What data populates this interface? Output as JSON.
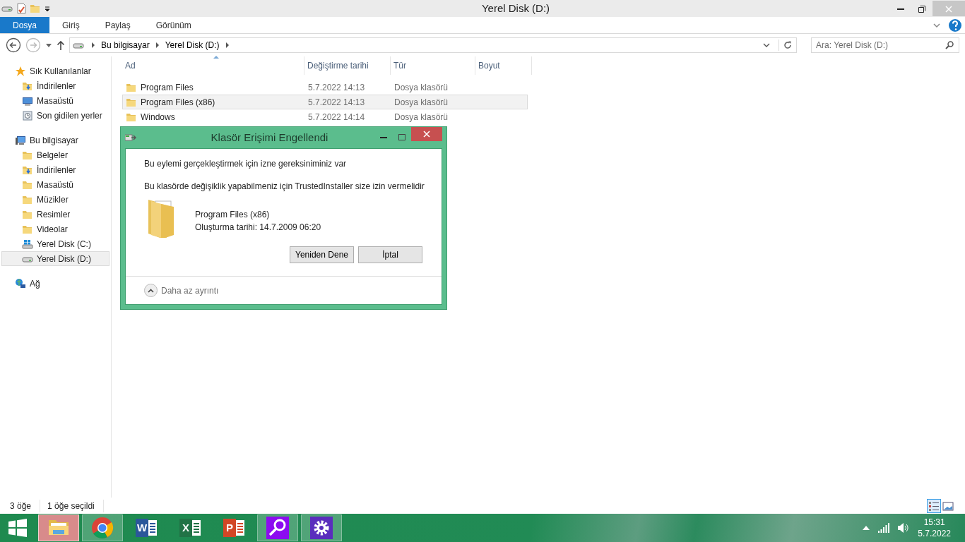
{
  "window": {
    "title": "Yerel Disk (D:)"
  },
  "ribbon_tabs": [
    {
      "label": "Dosya",
      "selected": true
    },
    {
      "label": "Giriş",
      "selected": false
    },
    {
      "label": "Paylaş",
      "selected": false
    },
    {
      "label": "Görünüm",
      "selected": false
    }
  ],
  "address": {
    "crumbs": [
      "Bu bilgisayar",
      "Yerel Disk (D:)"
    ]
  },
  "search": {
    "placeholder": "Ara: Yerel Disk (D:)"
  },
  "sidebar": [
    {
      "label": "Sık Kullanılanlar",
      "kind": "star",
      "selected": false,
      "children": [
        {
          "label": "İndirilenler",
          "kind": "download",
          "selected": false
        },
        {
          "label": "Masaüstü",
          "kind": "desktop",
          "selected": false
        },
        {
          "label": "Son gidilen yerler",
          "kind": "recent",
          "selected": false
        }
      ]
    },
    {
      "label": "Bu bilgisayar",
      "kind": "computer",
      "selected": false,
      "children": [
        {
          "label": "Belgeler",
          "kind": "folder",
          "selected": false
        },
        {
          "label": "İndirilenler",
          "kind": "download",
          "selected": false
        },
        {
          "label": "Masaüstü",
          "kind": "folder",
          "selected": false
        },
        {
          "label": "Müzikler",
          "kind": "folder",
          "selected": false
        },
        {
          "label": "Resimler",
          "kind": "folder",
          "selected": false
        },
        {
          "label": "Videolar",
          "kind": "folder",
          "selected": false
        },
        {
          "label": "Yerel Disk (C:)",
          "kind": "windrive",
          "selected": false
        },
        {
          "label": "Yerel Disk (D:)",
          "kind": "drive",
          "selected": true
        }
      ]
    },
    {
      "label": "Ağ",
      "kind": "network",
      "selected": false
    }
  ],
  "table": {
    "columns": [
      {
        "label": "Ad",
        "sorted": true
      },
      {
        "label": "Değiştirme tarihi",
        "sorted": false
      },
      {
        "label": "Tür",
        "sorted": false
      },
      {
        "label": "Boyut",
        "sorted": false
      }
    ],
    "rows": [
      {
        "name": "Program Files",
        "date": "5.7.2022 14:13",
        "type": "Dosya klasörü",
        "selected": false
      },
      {
        "name": "Program Files (x86)",
        "date": "5.7.2022 14:13",
        "type": "Dosya klasörü",
        "selected": true
      },
      {
        "name": "Windows",
        "date": "5.7.2022 14:14",
        "type": "Dosya klasörü",
        "selected": false
      }
    ]
  },
  "dialog": {
    "title": "Klasör Erişimi Engellendi",
    "message": "Bu eylemi gerçekleştirmek için izne gereksiniminiz var",
    "detail": "Bu klasörde değişiklik yapabilmeniz için TrustedInstaller size izin vermelidir",
    "file_name": "Program Files (x86)",
    "created": "Oluşturma tarihi: 14.7.2009 06:20",
    "buttons": [
      "Yeniden Dene",
      "İptal"
    ],
    "toggle": "Daha az ayrıntı"
  },
  "status_bar": {
    "count": "3 öğe",
    "selection": "1 öğe seçildi",
    "views": [
      {
        "kind": "details",
        "selected": true
      },
      {
        "kind": "preview",
        "selected": false
      }
    ]
  },
  "taskbar": {
    "apps": [
      {
        "kind": "explorer",
        "active": true,
        "running": true
      },
      {
        "kind": "chrome",
        "active": false,
        "running": true
      },
      {
        "kind": "word",
        "letter": "W",
        "active": false,
        "running": false
      },
      {
        "kind": "excel",
        "letter": "X",
        "active": false,
        "running": false
      },
      {
        "kind": "powerpoint",
        "letter": "P",
        "active": false,
        "running": false
      },
      {
        "kind": "search",
        "active": false,
        "running": true
      },
      {
        "kind": "settings",
        "active": false,
        "running": true
      }
    ],
    "time": "15:31",
    "date": "5.7.2022"
  }
}
